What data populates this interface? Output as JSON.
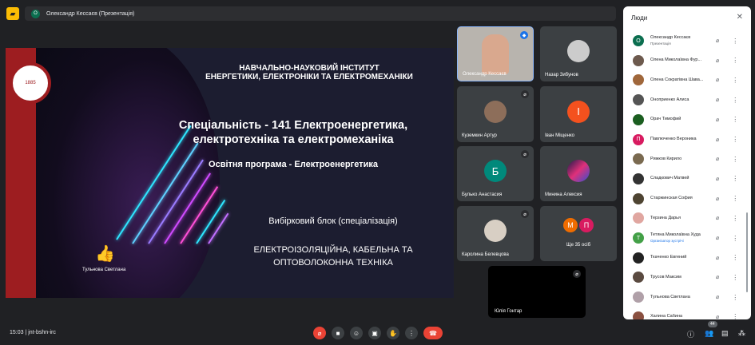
{
  "header": {
    "presenter_initial": "О",
    "presenter_label": "Олександр Кессаєв (Презентація)"
  },
  "slide": {
    "line1": "НАВЧАЛЬНО-НАУКОВИЙ ІНСТИТУТ",
    "line2": "ЕНЕРГЕТИКИ, ЕЛЕКТРОНІКИ ТА ЕЛЕКТРОМЕХАНІКИ",
    "specialty1": "Спеціальність - 141 Електроенергетика,",
    "specialty2": "електротехніка та електромеханіка",
    "program": "Освітня програма - Електроенергетика",
    "block": "Вибірковий блок (спеціалізація)",
    "spec1": "ЕЛЕКТРОІЗОЛЯЦІЙНА, КАБЕЛЬНА ТА",
    "spec2": "ОПТОВОЛОКОННА ТЕХНІКА",
    "logo_year": "1885",
    "reaction_name": "Тульнова Светлана"
  },
  "tiles": [
    {
      "name": "Олександр Кессаєв"
    },
    {
      "name": "Назар Зибунов"
    },
    {
      "name": "Куземкин Артур"
    },
    {
      "name": "Іван Міщенко",
      "initial": "І",
      "color": "#f4511e"
    },
    {
      "name": "Булько Анастасия",
      "initial": "Б",
      "color": "#00897b"
    },
    {
      "name": "Минина Алексия"
    },
    {
      "name": "Каролина Белевцова"
    },
    {
      "name": "Ще 35 осіб",
      "i1": "М",
      "i2": "П"
    },
    {
      "name": "Юлія Гонтар"
    }
  ],
  "people": {
    "title": "Люди",
    "list": [
      {
        "name": "Олександр Кессаєв",
        "sub": "Презентація",
        "initial": "О",
        "color": "#0b6e4f"
      },
      {
        "name": "Олена Миколаївна Фур...",
        "color": "#6d5a4e"
      },
      {
        "name": "Олена Сократівна Шава...",
        "color": "#a0673b"
      },
      {
        "name": "Оноприенко Алиса",
        "color": "#555"
      },
      {
        "name": "Орач Тимофий",
        "color": "#1b5e20"
      },
      {
        "name": "Павлюченко Вероника",
        "initial": "П",
        "color": "#d81b60"
      },
      {
        "name": "Рижков Кирило",
        "color": "#7a6a50"
      },
      {
        "name": "Сладкович Матвей",
        "color": "#333"
      },
      {
        "name": "Старжинская София",
        "color": "#4e4432"
      },
      {
        "name": "Терзина Дарья",
        "color": "#e0a6a0"
      },
      {
        "name": "Тетяна Миколаївна Худа",
        "sub": "Організатор зустрічі",
        "initial": "Т",
        "color": "#43a047"
      },
      {
        "name": "Ткаченко Евгений",
        "color": "#222"
      },
      {
        "name": "Трусов Максим",
        "color": "#5a4a40"
      },
      {
        "name": "Тульнова Светлана",
        "color": "#b0a0a8"
      },
      {
        "name": "Халина Сабина",
        "color": "#8a5040"
      }
    ]
  },
  "bottom": {
    "time": "15:03",
    "code": "jnt-bshn-irc",
    "people_count": "44"
  }
}
